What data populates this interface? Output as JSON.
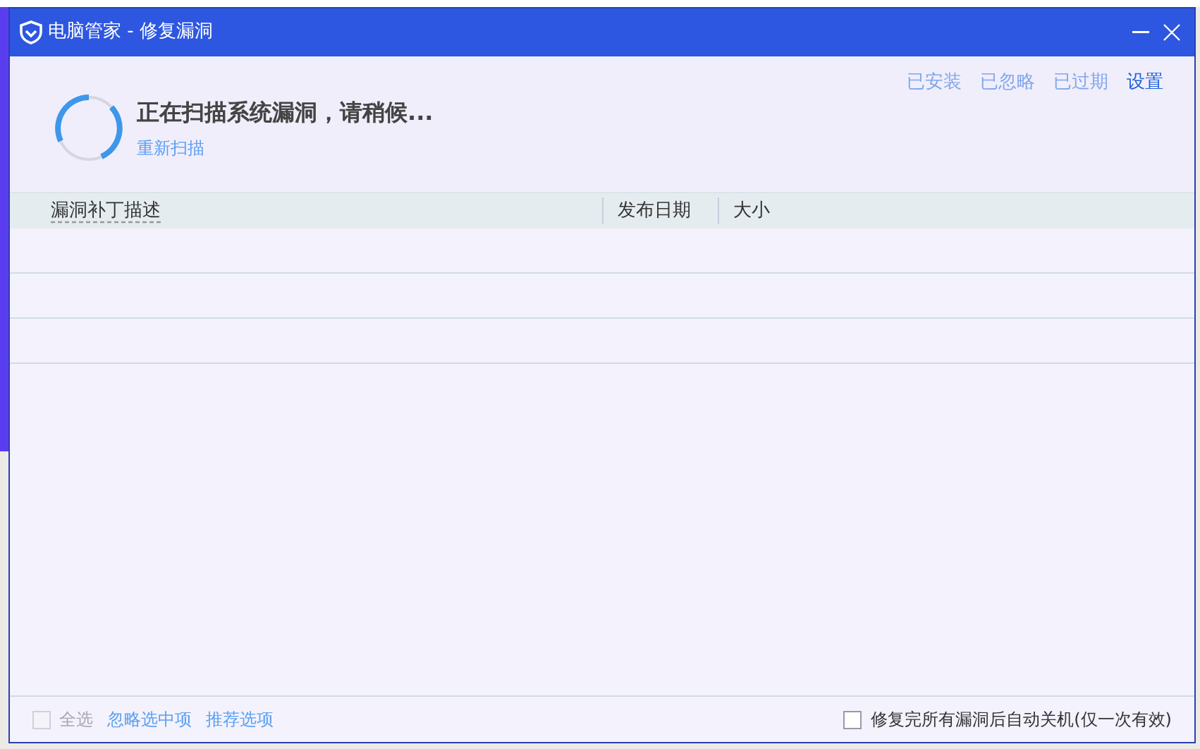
{
  "window": {
    "title": "电脑管家 - 修复漏洞"
  },
  "nav_links": [
    {
      "label": "已安装",
      "kind": "filter"
    },
    {
      "label": "已忽略",
      "kind": "filter"
    },
    {
      "label": "已过期",
      "kind": "filter"
    },
    {
      "label": "设置",
      "kind": "settings"
    }
  ],
  "status": {
    "message": "正在扫描系统漏洞，请稍候...",
    "rescan": "重新扫描"
  },
  "table": {
    "columns": [
      "漏洞补丁描述",
      "发布日期",
      "大小"
    ]
  },
  "footer": {
    "select_all": {
      "label": "全选",
      "checked": false,
      "disabled": true
    },
    "links": [
      "忽略选中项",
      "推荐选项"
    ],
    "auto_shutdown": {
      "label": "修复完所有漏洞后自动关机(仅一次有效)",
      "checked": false
    }
  }
}
